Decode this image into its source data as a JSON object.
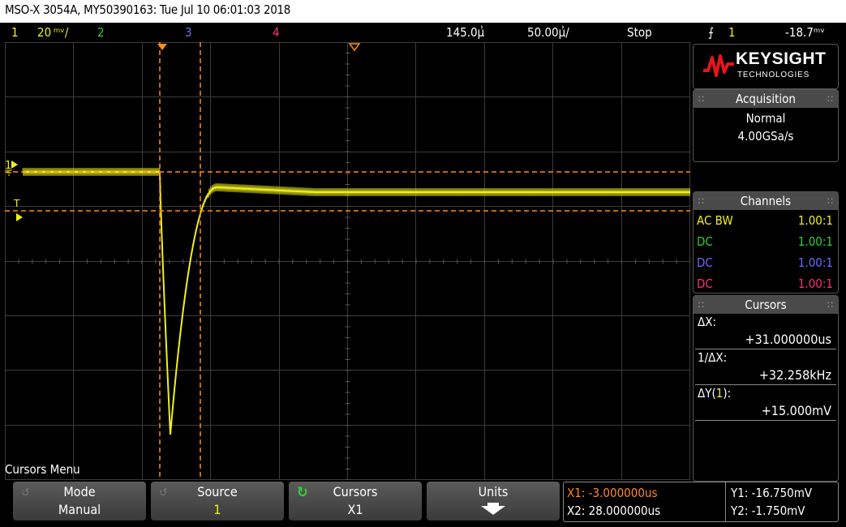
{
  "window_title": "MSO-X 3054A, MY50390163: Tue Jul 10 06:01:03 2018",
  "status_bar": {
    "ch1_number": "1",
    "ch1_scale": "20 ᵐᵛ/",
    "ch2_number": "2",
    "ch3_number": "3",
    "ch4_number": "4",
    "time_delay": "145.0µ͗",
    "time_scale": "50.00µ͗/",
    "run_state": "Stop",
    "trigger_symbol": "⨍",
    "trigger_source": "1",
    "trigger_level": "-18.7ᵐᵛ"
  },
  "colors": {
    "ch1": "#f0f020",
    "ch2": "#32d232",
    "ch3": "#6b6bff",
    "ch4": "#ff2d7a",
    "cursor": "#ff8a1e",
    "grid": "#3c3c3c"
  },
  "logo": {
    "brand": "KEYSIGHT",
    "sub": "TECHNOLOGIES"
  },
  "acquisition": {
    "header": "Acquisition",
    "mode": "Normal",
    "rate": "4.00GSa/s"
  },
  "channels": {
    "header": "Channels",
    "rows": [
      {
        "coupling": "AC BW",
        "ratio": "1.00:1"
      },
      {
        "coupling": "DC",
        "ratio": "1.00:1"
      },
      {
        "coupling": "DC",
        "ratio": "1.00:1"
      },
      {
        "coupling": "DC",
        "ratio": "1.00:1"
      }
    ]
  },
  "cursors_panel": {
    "header": "Cursors",
    "dx_label": "ΔX:",
    "dx_value": "+31.000000us",
    "inv_dx_label": "1/ΔX:",
    "inv_dx_value": "+32.258kHz",
    "dy_label_prefix": "ΔY(",
    "dy_label_ch": "1",
    "dy_label_suffix": "):",
    "dy_value": "+15.000mV"
  },
  "menu": {
    "title": "Cursors Menu",
    "softkeys": [
      {
        "title": "Mode",
        "value": "Manual"
      },
      {
        "title": "Source",
        "value": "1"
      },
      {
        "title": "Cursors",
        "value": "X1"
      },
      {
        "title": "Units",
        "value": ""
      }
    ]
  },
  "cursor_readout": {
    "x1": "X1: -3.000000us",
    "x2": "X2: 28.000000us",
    "y1": "Y1: -16.750mV",
    "y2": "Y2: -1.750mV"
  }
}
